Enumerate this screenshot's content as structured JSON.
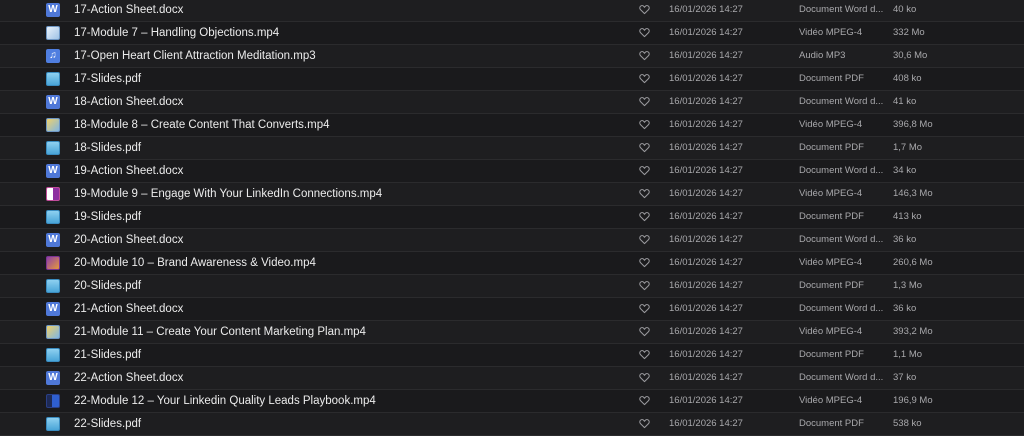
{
  "files": [
    {
      "name": "17-Action Sheet.docx",
      "icon": "word-document-icon",
      "date": "16/01/2026 14:27",
      "kind": "Document Word d...",
      "size": "40 ko"
    },
    {
      "name": "17-Module 7 – Handling Objections.mp4",
      "icon": "video-file-icon",
      "date": "16/01/2026 14:27",
      "kind": "Vidéo MPEG-4",
      "size": "332 Mo"
    },
    {
      "name": "17-Open Heart Client Attraction Meditation.mp3",
      "icon": "audio-file-icon",
      "date": "16/01/2026 14:27",
      "kind": "Audio MP3",
      "size": "30,6 Mo"
    },
    {
      "name": "17-Slides.pdf",
      "icon": "pdf-document-icon",
      "date": "16/01/2026 14:27",
      "kind": "Document PDF",
      "size": "408 ko"
    },
    {
      "name": "18-Action Sheet.docx",
      "icon": "word-document-icon",
      "date": "16/01/2026 14:27",
      "kind": "Document Word d...",
      "size": "41 ko"
    },
    {
      "name": "18-Module 8 – Create Content That Converts.mp4",
      "icon": "video-file-icon",
      "date": "16/01/2026 14:27",
      "kind": "Vidéo MPEG-4",
      "size": "396,8 Mo"
    },
    {
      "name": "18-Slides.pdf",
      "icon": "pdf-document-icon",
      "date": "16/01/2026 14:27",
      "kind": "Document PDF",
      "size": "1,7 Mo"
    },
    {
      "name": "19-Action Sheet.docx",
      "icon": "word-document-icon",
      "date": "16/01/2026 14:27",
      "kind": "Document Word d...",
      "size": "34 ko"
    },
    {
      "name": "19-Module 9 – Engage With Your LinkedIn Connections.mp4",
      "icon": "video-file-icon",
      "date": "16/01/2026 14:27",
      "kind": "Vidéo MPEG-4",
      "size": "146,3 Mo"
    },
    {
      "name": "19-Slides.pdf",
      "icon": "pdf-document-icon",
      "date": "16/01/2026 14:27",
      "kind": "Document PDF",
      "size": "413 ko"
    },
    {
      "name": "20-Action Sheet.docx",
      "icon": "word-document-icon",
      "date": "16/01/2026 14:27",
      "kind": "Document Word d...",
      "size": "36 ko"
    },
    {
      "name": "20-Module 10 – Brand Awareness & Video.mp4",
      "icon": "video-file-icon",
      "date": "16/01/2026 14:27",
      "kind": "Vidéo MPEG-4",
      "size": "260,6 Mo"
    },
    {
      "name": "20-Slides.pdf",
      "icon": "pdf-document-icon",
      "date": "16/01/2026 14:27",
      "kind": "Document PDF",
      "size": "1,3 Mo"
    },
    {
      "name": "21-Action Sheet.docx",
      "icon": "word-document-icon",
      "date": "16/01/2026 14:27",
      "kind": "Document Word d...",
      "size": "36 ko"
    },
    {
      "name": "21-Module 11 – Create Your Content Marketing Plan.mp4",
      "icon": "video-file-icon",
      "date": "16/01/2026 14:27",
      "kind": "Vidéo MPEG-4",
      "size": "393,2 Mo"
    },
    {
      "name": "21-Slides.pdf",
      "icon": "pdf-document-icon",
      "date": "16/01/2026 14:27",
      "kind": "Document PDF",
      "size": "1,1 Mo"
    },
    {
      "name": "22-Action Sheet.docx",
      "icon": "word-document-icon",
      "date": "16/01/2026 14:27",
      "kind": "Document Word d...",
      "size": "37 ko"
    },
    {
      "name": "22-Module 12 – Your Linkedin Quality Leads Playbook.mp4",
      "icon": "video-file-icon",
      "date": "16/01/2026 14:27",
      "kind": "Vidéo MPEG-4",
      "size": "196,9 Mo"
    },
    {
      "name": "22-Slides.pdf",
      "icon": "pdf-document-icon",
      "date": "16/01/2026 14:27",
      "kind": "Document PDF",
      "size": "538 ko"
    }
  ],
  "favorite_icon": "heart-outline-icon",
  "colors": {
    "background": "#1c1c1e",
    "row_divider": "#2b2b2d",
    "text_primary": "#ececec",
    "text_secondary": "#a9a9ac",
    "word_icon": "#4f78d8"
  }
}
